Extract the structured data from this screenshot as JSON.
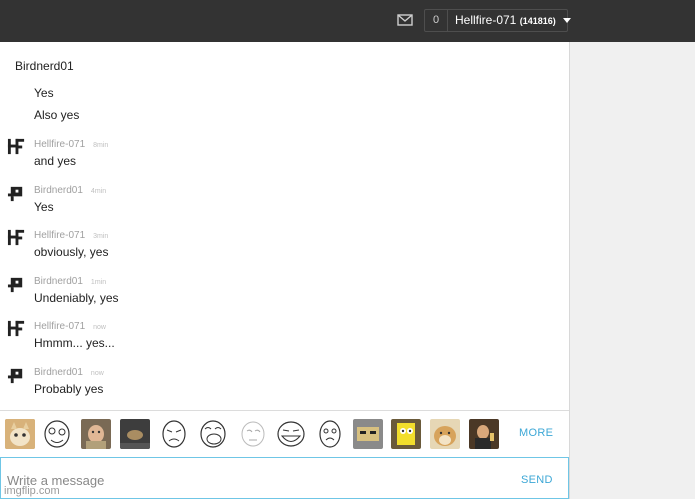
{
  "header": {
    "notification_count": "0",
    "username": "Hellfire-071",
    "user_points": "(141816)",
    "icons": {
      "mail": "mail-icon",
      "dropdown": "caret-down-icon"
    }
  },
  "chat": {
    "first_author": "Birdnerd01",
    "first_messages": [
      "Yes",
      "Also yes"
    ],
    "messages": [
      {
        "author": "Hellfire-071",
        "time": "8min",
        "text": "and yes",
        "avatar": "hf-avatar"
      },
      {
        "author": "Birdnerd01",
        "time": "4min",
        "text": "Yes",
        "avatar": "bird-avatar"
      },
      {
        "author": "Hellfire-071",
        "time": "3min",
        "text": "obviously, yes",
        "avatar": "hf-avatar"
      },
      {
        "author": "Birdnerd01",
        "time": "1min",
        "text": "Undeniably, yes",
        "avatar": "bird-avatar"
      },
      {
        "author": "Hellfire-071",
        "time": "now",
        "text": "Hmmm... yes...",
        "avatar": "hf-avatar"
      },
      {
        "author": "Birdnerd01",
        "time": "now",
        "text": "Probably yes",
        "avatar": "bird-avatar"
      }
    ]
  },
  "emoji_bar": {
    "items": [
      "cat-meme",
      "derp-face",
      "success-kid",
      "pigeon-meme",
      "sad-face",
      "laughing-face",
      "okay-face",
      "troll-face",
      "rage-face",
      "grumpy-dog",
      "spongebob",
      "doge",
      "toast-man"
    ],
    "more_label": "MORE"
  },
  "composer": {
    "placeholder": "Write a message",
    "send_label": "SEND"
  },
  "watermark": "imgflip.com",
  "colors": {
    "topbar": "#333333",
    "accent": "#3ca7d6",
    "right_panel": "#f0f0f0"
  }
}
